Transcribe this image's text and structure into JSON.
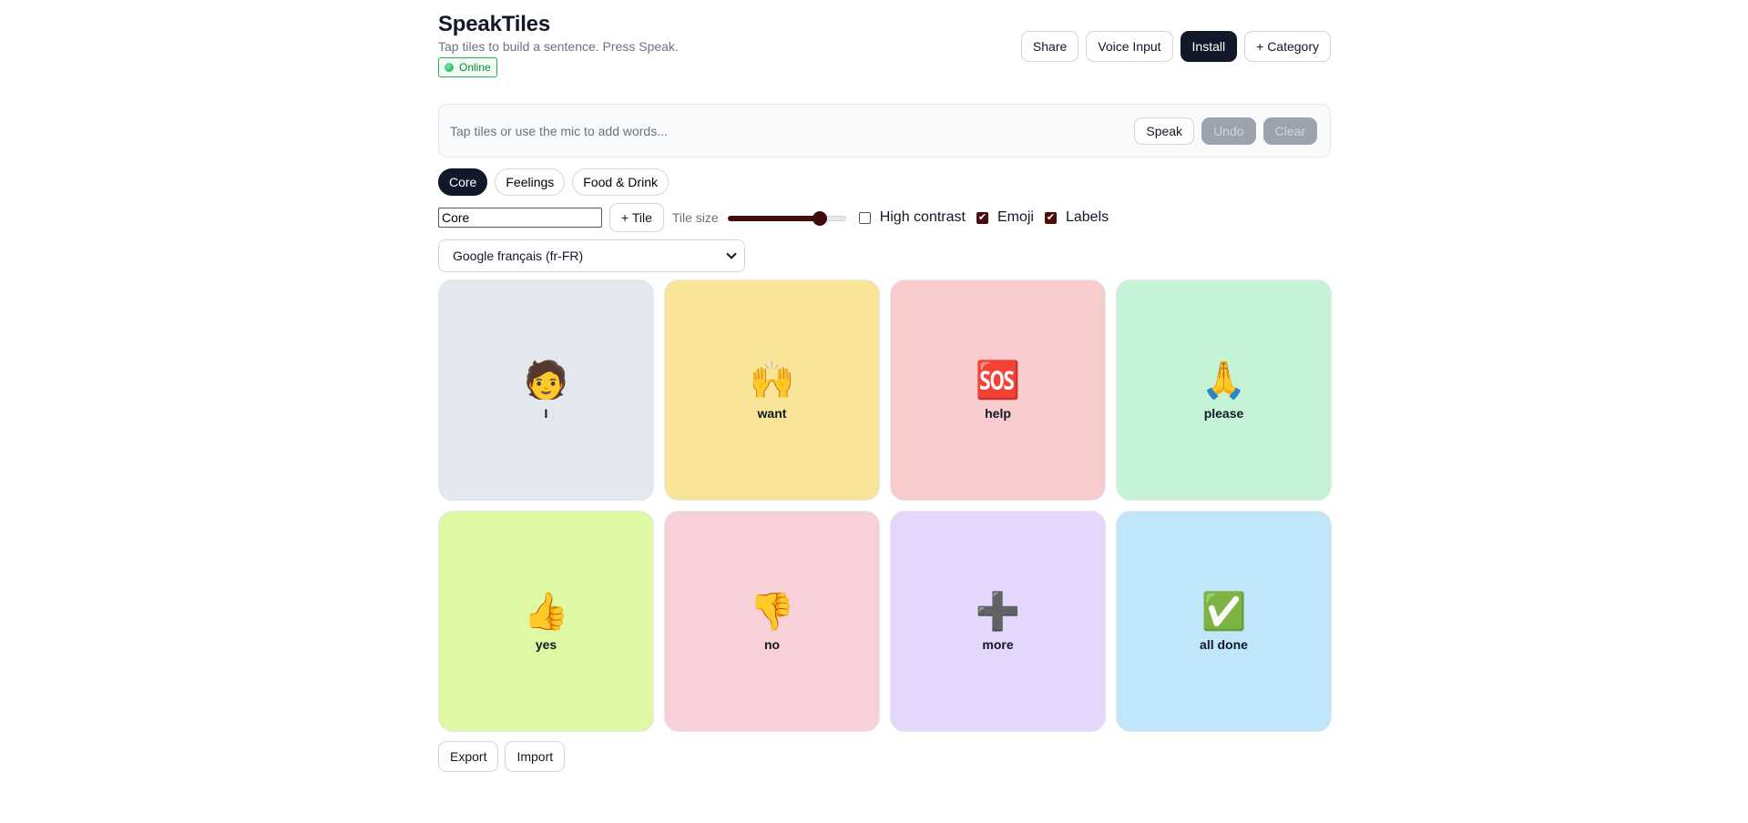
{
  "app": {
    "title": "SpeakTiles",
    "subtitle": "Tap tiles to build a sentence. Press Speak.",
    "status": "Online"
  },
  "header_actions": {
    "share": "Share",
    "voice_input": "Voice Input",
    "install": "Install",
    "add_category": "+ Category"
  },
  "sentence": {
    "placeholder": "Tap tiles or use the mic to add words...",
    "speak": "Speak",
    "undo": "Undo",
    "clear": "Clear"
  },
  "tabs": [
    {
      "label": "Core",
      "active": true
    },
    {
      "label": "Feelings",
      "active": false
    },
    {
      "label": "Food & Drink",
      "active": false
    }
  ],
  "tools": {
    "category_name_value": "Core",
    "add_tile": "+ Tile",
    "tile_size_label": "Tile size",
    "tile_size_fraction": 0.82,
    "high_contrast_label": "High contrast",
    "high_contrast_checked": false,
    "emoji_label": "Emoji",
    "emoji_checked": true,
    "labels_label": "Labels",
    "labels_checked": true
  },
  "voice_select": {
    "selected": "Google français (fr-FR)"
  },
  "tiles": [
    {
      "emoji": "🧑",
      "label": "I",
      "color": "#e3e7ee"
    },
    {
      "emoji": "🙌",
      "label": "want",
      "color": "#f9e597"
    },
    {
      "emoji": "🆘",
      "label": "help",
      "color": "#f8cccc"
    },
    {
      "emoji": "🙏",
      "label": "please",
      "color": "#c4f4d5"
    },
    {
      "emoji": "👍",
      "label": "yes",
      "color": "#def8a4"
    },
    {
      "emoji": "👎",
      "label": "no",
      "color": "#f8d0d7"
    },
    {
      "emoji": "➕",
      "label": "more",
      "color": "#e5d6fb"
    },
    {
      "emoji": "✅",
      "label": "all done",
      "color": "#c0e6f9"
    }
  ],
  "footer": {
    "export": "Export",
    "import": "Import"
  },
  "colors": {
    "dark_button": "#111827",
    "slider_accent": "#3f0d0d",
    "online_green": "#15803d"
  }
}
